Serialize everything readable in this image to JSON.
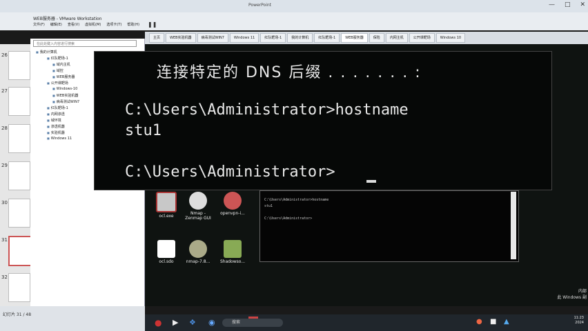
{
  "window": {
    "title": "WEB服务器 - VMware Workstation",
    "ppt_title": "PowerPoint"
  },
  "menubar": {
    "items": [
      "文件(F)",
      "编辑(E)",
      "查看(V)",
      "虚拟机(M)",
      "选项卡(T)",
      "帮助(H)"
    ]
  },
  "tabs": [
    "主页",
    "WEB实验机器",
    "病毒测试WIN7",
    "Windows 11",
    "红队靶场-1",
    "我的计算机",
    "红队靶场-1",
    "WEB服务器",
    "保险",
    "内网主机",
    "公开课靶场",
    "Windows 10"
  ],
  "library": {
    "search_placeholder": "在此处键入内容进行搜索",
    "tree": [
      "我的计算机",
      "红队靶场-1",
      "域内主机",
      "域控",
      "WEB服务器",
      "公开课靶场",
      "Windows-10",
      "WEB实验机器",
      "病毒测试WIN7",
      "红队靶场-1",
      "内网渗透",
      "域环境",
      "渗透机器",
      "实验机器",
      "Windows 11"
    ]
  },
  "slides": {
    "numbers": [
      "26",
      "27",
      "28",
      "29",
      "30",
      "31",
      "32"
    ]
  },
  "cmd_large": {
    "line0": "连接特定的 DNS 后缀 . . . . . . . :",
    "line1": "C:\\Users\\Administrator>hostname",
    "line2": "stu1",
    "line3": "C:\\Users\\Administrator>"
  },
  "cmd_small": {
    "line1": "C:\\Users\\Administrator>hostname",
    "line2": "stu1",
    "line3": "C:\\Users\\Administrator>"
  },
  "desktop_icons": [
    {
      "label": "ocl.exe",
      "color": "#a33"
    },
    {
      "label": "Nmap - Zenmap GUI",
      "color": "#ddd"
    },
    {
      "label": "openvpn-i...",
      "color": "#c55"
    },
    {
      "label": "ocl.sdo",
      "color": "#fff"
    },
    {
      "label": "nmap-7.8...",
      "color": "#aa8"
    },
    {
      "label": "Shadowso...",
      "color": "#8a5"
    }
  ],
  "taskbar": {
    "search": "搜索",
    "time": "11:23",
    "date": "2024"
  },
  "watermark": {
    "line1": "内部",
    "line2": "此 Windows 副"
  },
  "statusbar": {
    "slide_indicator": "幻灯片 31 / 48"
  }
}
